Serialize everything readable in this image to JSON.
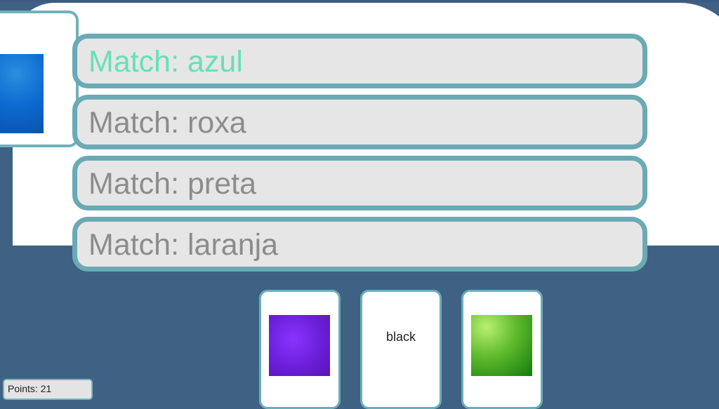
{
  "prompt_card": {
    "swatch_color": "#0c6ad0",
    "icon": "blue-color-swatch"
  },
  "matches": [
    {
      "label": "Match: azul",
      "active": true
    },
    {
      "label": "Match: roxa",
      "active": false
    },
    {
      "label": "Match: preta",
      "active": false
    },
    {
      "label": "Match: laranja",
      "active": false
    }
  ],
  "cards": [
    {
      "type": "swatch",
      "color": "#7a22ee",
      "icon": "purple-color-swatch"
    },
    {
      "type": "word",
      "text": "black"
    },
    {
      "type": "swatch",
      "color": "#4caa22",
      "icon": "green-color-swatch"
    }
  ],
  "score": {
    "label": "Points: 21"
  },
  "colors": {
    "background": "#3f6184",
    "accent": "#6aaab5",
    "active_text": "#66e0b6",
    "inactive_text": "#8c8c8c"
  }
}
